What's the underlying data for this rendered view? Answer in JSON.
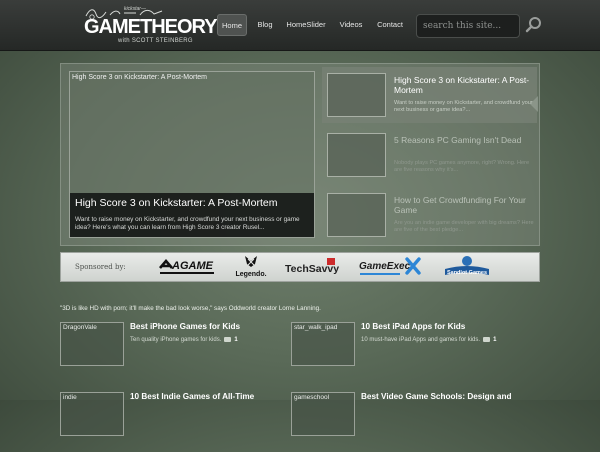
{
  "header": {
    "logo": {
      "scribble": "kickstar—",
      "main": "GAMETHEORY",
      "tm": "™",
      "sub": "with SCOTT STEINBERG"
    },
    "nav": [
      {
        "label": "Home",
        "active": true
      },
      {
        "label": "Blog"
      },
      {
        "label": "HomeSlider"
      },
      {
        "label": "Videos"
      },
      {
        "label": "Contact"
      }
    ],
    "search": {
      "placeholder": "search this site...",
      "icon": "magnifier-icon"
    }
  },
  "featured": {
    "image_alt": "High Score 3 on Kickstarter: A Post-Mortem",
    "title": "High Score 3 on Kickstarter: A Post-Mortem",
    "desc": "Want to raise money on Kickstarter, and crowdfund your next business or game idea? Here's what you can learn from High Score 3 creator Rusel...",
    "thumbs": [
      {
        "title": "High Score 3 on Kickstarter: A Post-Mortem",
        "desc": "Want to raise money on Kickstarter, and crowdfund your next business or game idea?..."
      },
      {
        "title": "5 Reasons PC Gaming Isn't Dead",
        "desc": "Nobody plays PC games anymore, right? Wrong. Here are five reasons why it's..."
      },
      {
        "title": "How to Get Crowdfunding For Your Game",
        "desc": "Are you an indie game developer with big dreams? Here are five of the best pledge..."
      }
    ]
  },
  "sponsors": {
    "label": "Sponsored by:",
    "logos": [
      "AGAME",
      "Legendo.",
      "TechSavvy",
      "GameExec",
      "Sandlot Games"
    ]
  },
  "quote": "\"3D is like HD with porn; it'll make the bad look worse,\" says Oddworld creator Lorne Lanning.",
  "posts": [
    {
      "image_alt": "DragonVale",
      "title": "Best iPhone Games for Kids",
      "desc": "Ten quality iPhone games for kids.",
      "comments": "1"
    },
    {
      "image_alt": "star_walk_ipad",
      "title": "10 Best iPad Apps for Kids",
      "desc": "10 must-have iPad Apps and games for kids.",
      "comments": "1"
    },
    {
      "image_alt": "indie",
      "title": "10 Best Indie Games of All-Time"
    },
    {
      "image_alt": "gameschool",
      "title": "Best Video Game Schools: Design and"
    }
  ],
  "colors": {
    "header": "#2d302e",
    "active_nav": "#4f5250",
    "caption_bg": "#121413",
    "sponsor_bg": "#e0e3e0"
  }
}
